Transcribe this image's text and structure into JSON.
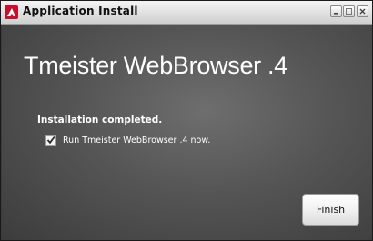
{
  "window": {
    "title": "Application Install",
    "app_icon": "adobe-air-icon",
    "controls": [
      "minimize-icon",
      "maximize-icon",
      "close-icon"
    ]
  },
  "installer": {
    "product_title": "Tmeister WebBrowser .4",
    "status": "Installation completed.",
    "run_after_install": {
      "label": "Run Tmeister WebBrowser .4 now.",
      "checked": true
    },
    "finish_label": "Finish"
  },
  "colors": {
    "accent_icon": "#c8102e",
    "content_background": "#555555",
    "text": "#ffffff"
  }
}
